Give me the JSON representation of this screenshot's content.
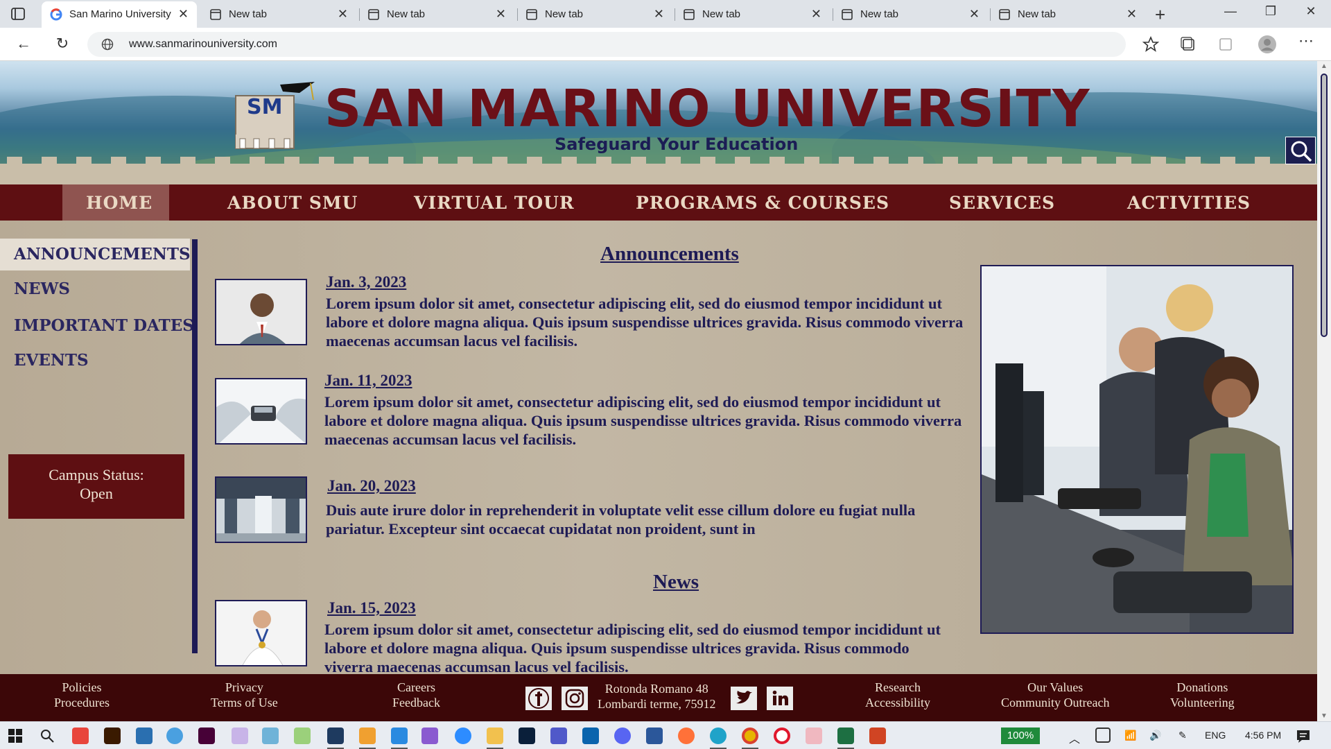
{
  "browser": {
    "tabs": [
      {
        "label": "San Marino University",
        "active": true
      },
      {
        "label": "New tab",
        "active": false
      },
      {
        "label": "New tab",
        "active": false
      },
      {
        "label": "New tab",
        "active": false
      },
      {
        "label": "New tab",
        "active": false
      },
      {
        "label": "New tab",
        "active": false
      },
      {
        "label": "New tab",
        "active": false
      }
    ],
    "url": "www.sanmarinouniversity.com"
  },
  "site": {
    "title": "SAN MARINO UNIVERSITY",
    "tagline": "Safeguard Your Education",
    "logo_letters": "SM"
  },
  "nav": {
    "items": [
      "HOME",
      "ABOUT SMU",
      "VIRTUAL TOUR",
      "PROGRAMS & COURSES",
      "SERVICES",
      "ACTIVITIES"
    ],
    "active": "HOME"
  },
  "sidebar": {
    "items": [
      "ANNOUNCEMENTS",
      "NEWS",
      "IMPORTANT DATES",
      "EVENTS"
    ],
    "active": "ANNOUNCEMENTS",
    "campus_status": {
      "label": "Campus Status:",
      "value": "Open"
    }
  },
  "announcements": {
    "heading": "Announcements",
    "entries": [
      {
        "date": "Jan. 3, 2023",
        "text": "Lorem ipsum dolor sit amet, consectetur adipiscing elit, sed do eiusmod tempor incididunt ut labore et dolore magna aliqua. Quis ipsum suspendisse ultrices gravida. Risus commodo viverra maecenas accumsan lacus vel facilisis."
      },
      {
        "date": "Jan. 11, 2023",
        "text": "Lorem ipsum dolor sit amet, consectetur adipiscing elit, sed do eiusmod tempor incididunt ut labore et dolore magna aliqua. Quis ipsum suspendisse ultrices gravida. Risus commodo viverra maecenas accumsan lacus vel facilisis."
      },
      {
        "date": "Jan. 20, 2023",
        "text": "Duis aute irure dolor in reprehenderit in voluptate velit esse cillum dolore eu fugiat nulla pariatur. Excepteur sint occaecat cupidatat non proident, sunt in"
      }
    ]
  },
  "news": {
    "heading": "News",
    "entries": [
      {
        "date": "Jan. 15, 2023",
        "text": "Lorem ipsum dolor sit amet, consectetur adipiscing elit, sed do eiusmod tempor incididunt ut labore et dolore magna aliqua. Quis ipsum suspendisse ultrices gravida. Risus commodo viverra maecenas accumsan lacus vel facilisis."
      }
    ]
  },
  "footer": {
    "policies": "Policies",
    "procedures": "Procedures",
    "privacy": "Privacy",
    "terms": "Terms of  Use",
    "careers": "Careers",
    "feedback": "Feedback",
    "address_line1": "Rotonda Romano 48",
    "address_line2": "Lombardi terme, 75912",
    "research": "Research",
    "accessibility": "Accessibility",
    "our_values": "Our Values",
    "community": "Community Outreach",
    "donations": "Donations",
    "volunteering": "Volunteering"
  },
  "taskbar": {
    "zoom": "100%",
    "language": "ENG",
    "time": "4:56 PM"
  },
  "colors": {
    "maroon": "#5e0f12",
    "navy": "#1e1b55",
    "parchment": "#b8ab96",
    "title_red": "#6b1018"
  }
}
